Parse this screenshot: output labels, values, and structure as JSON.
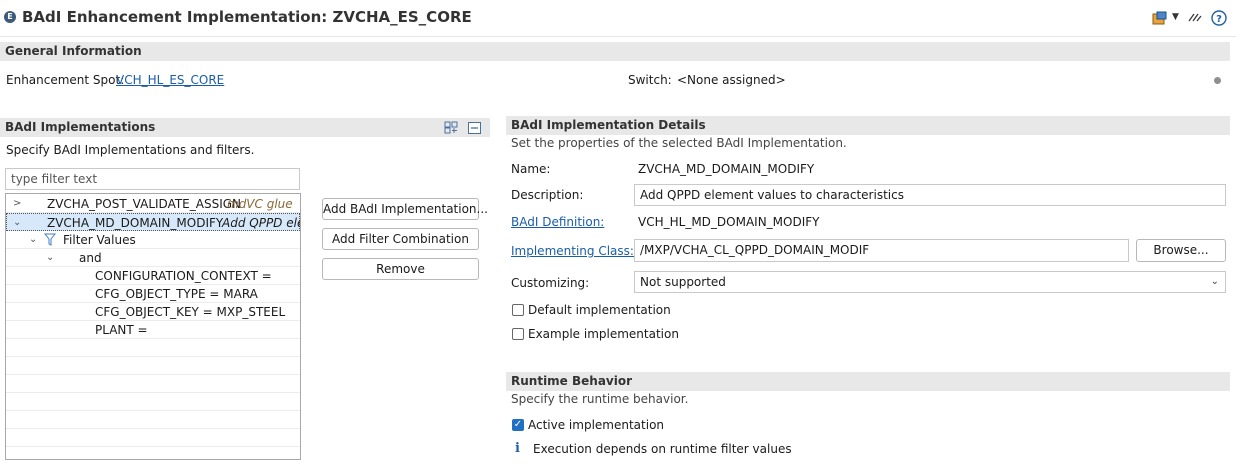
{
  "header": {
    "title": "BAdI Enhancement Implementation: ZVCHA_ES_CORE",
    "icon_letter": "E",
    "toolbar_icons": [
      "object-navigator-icon",
      "dropdown-icon",
      "link-editor-icon",
      "help-icon"
    ]
  },
  "general": {
    "section_title": "General Information",
    "spot_label": "Enhancement Spot:",
    "spot_value": "VCH_HL_ES_CORE",
    "switch_label": "Switch:",
    "switch_value": "<None assigned>"
  },
  "implementations": {
    "section_title": "BAdI Implementations",
    "description": "Specify BAdI Implementations and filters.",
    "filter_placeholder": "type filter text",
    "tree": [
      {
        "name": "ZVCHA_POST_VALIDATE_ASSIGN",
        "note": "mdVC glue"
      },
      {
        "name": "ZVCHA_MD_DOMAIN_MODIFY",
        "note": "Add QPPD ele"
      },
      {
        "name": "Filter Values"
      },
      {
        "name": "and"
      },
      {
        "name": "CONFIGURATION_CONTEXT ="
      },
      {
        "name": "CFG_OBJECT_TYPE = MARA"
      },
      {
        "name": "CFG_OBJECT_KEY = MXP_STEEL"
      },
      {
        "name": "PLANT ="
      }
    ],
    "buttons": {
      "add": "Add BAdI Implementation...",
      "add_filter": "Add Filter Combination",
      "remove": "Remove"
    }
  },
  "details": {
    "section_title": "BAdI Implementation Details",
    "description": "Set the properties of the selected BAdI Implementation.",
    "name_label": "Name:",
    "name_value": "ZVCHA_MD_DOMAIN_MODIFY",
    "desc_label": "Description:",
    "desc_value": "Add QPPD element values to characteristics",
    "badi_def_label": "BAdI Definition:",
    "badi_def_value": "VCH_HL_MD_DOMAIN_MODIFY",
    "impl_class_label": "Implementing Class: *",
    "impl_class_value": "/MXP/VCHA_CL_QPPD_DOMAIN_MODIF",
    "browse_label": "Browse...",
    "customizing_label": "Customizing:",
    "customizing_value": "Not supported",
    "default_impl_label": "Default implementation",
    "default_impl_checked": false,
    "example_impl_label": "Example implementation",
    "example_impl_checked": false
  },
  "runtime": {
    "section_title": "Runtime Behavior",
    "description": "Specify the runtime behavior.",
    "active_label": "Active implementation",
    "active_checked": true,
    "info_text": "Execution depends on runtime filter values"
  }
}
